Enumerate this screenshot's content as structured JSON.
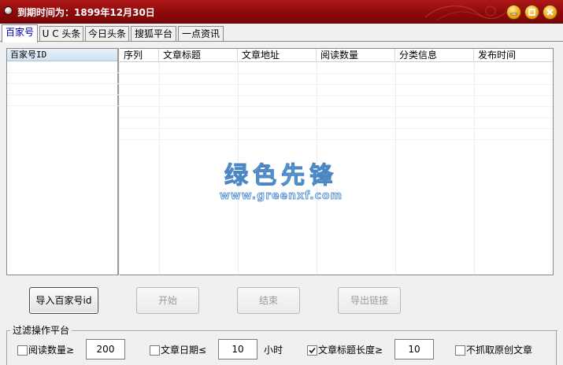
{
  "window": {
    "title": "到期时间为：1899年12月30日",
    "accent_color": "#9a0c0c",
    "controls": [
      "minimize-icon",
      "maximize-icon",
      "close-icon"
    ]
  },
  "tabs": [
    {
      "label": "百家号",
      "active": true
    },
    {
      "label": "U C 头条",
      "active": false
    },
    {
      "label": "今日头条",
      "active": false
    },
    {
      "label": "搜狐平台",
      "active": false
    },
    {
      "label": "一点资讯",
      "active": false
    }
  ],
  "id_list": {
    "header": "百家号ID",
    "rows": []
  },
  "article_table": {
    "columns": [
      "序列",
      "文章标题",
      "文章地址",
      "阅读数量",
      "分类信息",
      "发布时间"
    ],
    "rows": []
  },
  "watermark": {
    "line1": "绿色先锋",
    "line2": "www.greenxf.com"
  },
  "actions": {
    "import_label": "导入百家号id",
    "start_label": "开始",
    "stop_label": "结束",
    "export_label": "导出链接"
  },
  "filter": {
    "title": "过滤操作平台",
    "read_count_label": "阅读数量≥",
    "read_count_value": "200",
    "read_count_checked": false,
    "date_label": "文章日期≤",
    "date_value": "10",
    "date_unit": "小时",
    "date_checked": false,
    "title_len_label": "文章标题长度≥",
    "title_len_value": "10",
    "title_len_checked": true,
    "no_original_label": "不抓取原创文章",
    "no_original_checked": false
  }
}
